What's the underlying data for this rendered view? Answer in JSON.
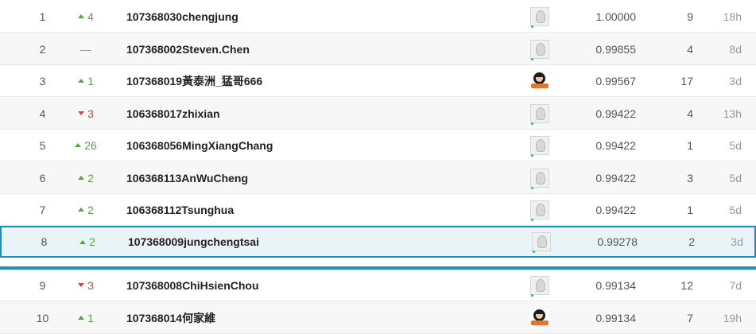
{
  "rows": [
    {
      "rank": "1",
      "change_dir": "up",
      "change": "4",
      "team": "107368030chengjung",
      "avatar": "default",
      "score": "1.00000",
      "entries": "9",
      "last": "18h"
    },
    {
      "rank": "2",
      "change_dir": "flat",
      "change": "—",
      "team": "107368002Steven.Chen",
      "avatar": "default",
      "score": "0.99855",
      "entries": "4",
      "last": "8d"
    },
    {
      "rank": "3",
      "change_dir": "up",
      "change": "1",
      "team": "107368019黃泰洲_猛哥666",
      "avatar": "cartoon",
      "score": "0.99567",
      "entries": "17",
      "last": "3d"
    },
    {
      "rank": "4",
      "change_dir": "down",
      "change": "3",
      "team": "106368017zhixian",
      "avatar": "default",
      "score": "0.99422",
      "entries": "4",
      "last": "13h"
    },
    {
      "rank": "5",
      "change_dir": "up",
      "change": "26",
      "team": "106368056MingXiangChang",
      "avatar": "default",
      "score": "0.99422",
      "entries": "1",
      "last": "5d"
    },
    {
      "rank": "6",
      "change_dir": "up",
      "change": "2",
      "team": "106368113AnWuCheng",
      "avatar": "default",
      "score": "0.99422",
      "entries": "3",
      "last": "5d"
    },
    {
      "rank": "7",
      "change_dir": "up",
      "change": "2",
      "team": "106368112Tsunghua",
      "avatar": "default",
      "score": "0.99422",
      "entries": "1",
      "last": "5d"
    },
    {
      "rank": "8",
      "change_dir": "up",
      "change": "2",
      "team": "107368009jungchengtsai",
      "avatar": "default",
      "score": "0.99278",
      "entries": "2",
      "last": "3d",
      "highlight": true
    },
    {
      "rank": "9",
      "change_dir": "down",
      "change": "3",
      "team": "107368008ChiHsienChou",
      "avatar": "default",
      "score": "0.99134",
      "entries": "12",
      "last": "7d"
    },
    {
      "rank": "10",
      "change_dir": "up",
      "change": "1",
      "team": "107368014何家維",
      "avatar": "cartoon",
      "score": "0.99134",
      "entries": "7",
      "last": "19h"
    }
  ],
  "colors": {
    "up": "#5aa14a",
    "down": "#c0504d",
    "highlight_border": "#1a8fb8",
    "highlight_bg": "#e9f4f8",
    "online_dot": "#2fbf71"
  },
  "icons": {
    "up": "triangle-up-icon",
    "down": "triangle-down-icon",
    "flat": "dash-icon"
  }
}
